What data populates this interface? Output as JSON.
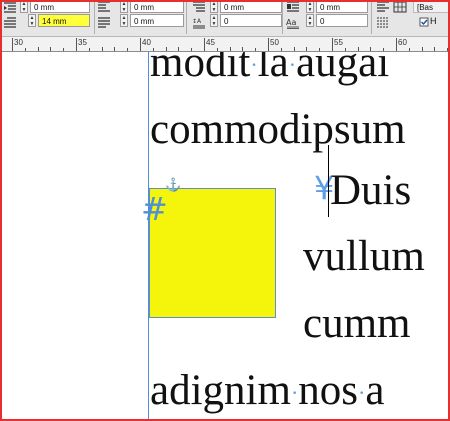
{
  "control_bar": {
    "row1": [
      "0 mm",
      "0 mm",
      "0 mm",
      "0 mm"
    ],
    "row2": {
      "left_indent_value": "14 mm",
      "right_indent_value": "0 mm",
      "space_after_value": "0",
      "drop_cap_lines_value": "0"
    },
    "baseline_label": "[Bas",
    "hyphenate_label": "H",
    "highlight_color": "#ffff3a"
  },
  "ruler": {
    "labels": [
      "30",
      "35",
      "40",
      "45",
      "50",
      "55",
      "60"
    ]
  },
  "document": {
    "lines": [
      "modit la augai",
      "commodipsum",
      "Duis",
      "vullum",
      "cumm",
      "adignim nos a"
    ],
    "frame_color": "#f5f50c",
    "guide_color": "#4f8fd9"
  },
  "icons": [
    "left-indent-icon",
    "first-line-indent-icon",
    "right-indent-icon",
    "space-before-icon",
    "space-after-icon",
    "drop-cap-icon",
    "align-left-icon",
    "align-grid-icon",
    "anchor-icon",
    "inline-frame-marker-icon",
    "yen-marker-icon"
  ]
}
